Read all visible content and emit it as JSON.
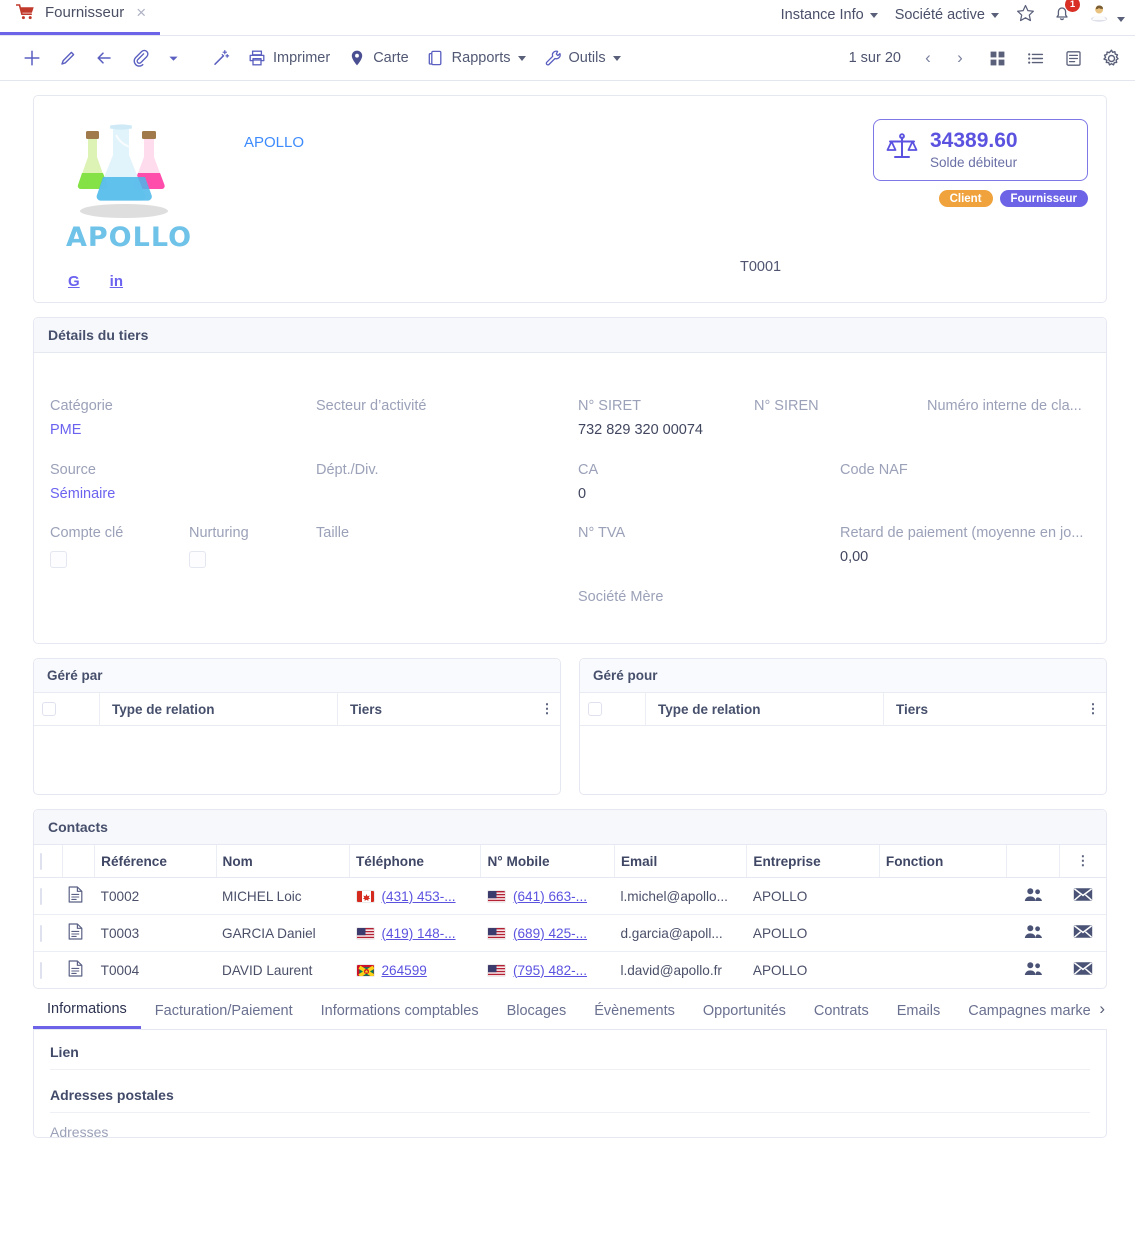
{
  "window": {
    "tab": {
      "icon": "cart-icon",
      "title": "Fournisseur",
      "close": "×"
    },
    "top_menus": [
      {
        "label": "Instance Info",
        "name": "instance-info-menu"
      },
      {
        "label": "Société active",
        "name": "active-company-menu"
      }
    ],
    "notification_count": "1"
  },
  "toolbar": {
    "buttons": [
      {
        "name": "new-button",
        "icon": "plus-icon",
        "label": ""
      },
      {
        "name": "edit-button",
        "icon": "pencil-icon",
        "label": ""
      },
      {
        "name": "back-button",
        "icon": "arrow-left-icon",
        "label": ""
      },
      {
        "name": "attachment-button",
        "icon": "paperclip-icon",
        "label": ""
      },
      {
        "name": "more-actions-button",
        "icon": "chevron-down-icon",
        "label": ""
      },
      {
        "name": "magic-button",
        "icon": "magic-wand-icon",
        "label": ""
      },
      {
        "name": "print-button",
        "icon": "printer-icon",
        "label": "Imprimer"
      },
      {
        "name": "map-button",
        "icon": "map-pin-icon",
        "label": "Carte"
      },
      {
        "name": "reports-button",
        "icon": "report-icon",
        "label": "Rapports"
      },
      {
        "name": "tools-button",
        "icon": "wrench-icon",
        "label": "Outils"
      }
    ],
    "pager": {
      "count_text": "1 sur 20",
      "prev": "‹",
      "next": "›"
    },
    "views": [
      "grid-view-icon",
      "list-view-icon",
      "detail-view-icon",
      "gear-icon"
    ]
  },
  "identity": {
    "logo_word": "APOLLO",
    "party_name": "APOLLO",
    "reference": "T0001",
    "social": [
      {
        "label": "G",
        "name": "google-link"
      },
      {
        "label": "in",
        "name": "linkedin-link"
      }
    ],
    "balance": {
      "icon": "scales-icon",
      "amount": "34389.60",
      "label": "Solde débiteur"
    },
    "chips": [
      {
        "label": "Client",
        "color": "#f0a23c"
      },
      {
        "label": "Fournisseur",
        "color": "#6d63e6"
      }
    ]
  },
  "details": {
    "title": "Détails du tiers",
    "fields": [
      {
        "label": "Catégorie",
        "value": "PME",
        "link": true
      },
      {
        "label": "Secteur d’activité",
        "value": ""
      },
      {
        "label": "N° SIRET",
        "value": "732 829 320 00074"
      },
      {
        "label": "N° SIREN",
        "value": ""
      },
      {
        "label": "Numéro interne de cla...",
        "value": ""
      },
      {
        "label": "Source",
        "value": "Séminaire",
        "link": true
      },
      {
        "label": "Dépt./Div.",
        "value": ""
      },
      {
        "label": "CA",
        "value": "0"
      },
      {
        "label": "Code NAF",
        "value": ""
      },
      {
        "label": "Compte clé",
        "value": "",
        "checkbox": true
      },
      {
        "label": "Nurturing",
        "value": "",
        "checkbox": true
      },
      {
        "label": "Taille",
        "value": ""
      },
      {
        "label": "N° TVA",
        "value": ""
      },
      {
        "label": "Retard de paiement (moyenne en jo...",
        "value": "0,00"
      },
      {
        "label": "Société Mère",
        "value": ""
      }
    ]
  },
  "relations": {
    "managed_by": {
      "title": "Géré par",
      "columns": [
        "Type de relation",
        "Tiers"
      ],
      "rows": []
    },
    "managed_for": {
      "title": "Géré pour",
      "columns": [
        "Type de relation",
        "Tiers"
      ],
      "rows": []
    }
  },
  "contacts": {
    "title": "Contacts",
    "columns": [
      "Référence",
      "Nom",
      "Téléphone",
      "N° Mobile",
      "Email",
      "Entreprise",
      "Fonction"
    ],
    "rows": [
      {
        "reference": "T0002",
        "nom": "MICHEL Loic",
        "telephone": "(431) 453-...",
        "telephone_flag": "CA",
        "mobile": "(641) 663-...",
        "mobile_flag": "US",
        "email": "l.michel@apollo...",
        "entreprise": "APOLLO",
        "fonction": ""
      },
      {
        "reference": "T0003",
        "nom": "GARCIA Daniel",
        "telephone": "(419) 148-...",
        "telephone_flag": "US",
        "mobile": "(689) 425-...",
        "mobile_flag": "US",
        "email": "d.garcia@apoll...",
        "entreprise": "APOLLO",
        "fonction": ""
      },
      {
        "reference": "T0004",
        "nom": "DAVID Laurent",
        "telephone": "264599",
        "telephone_flag": "GD",
        "mobile": "(795) 482-...",
        "mobile_flag": "US",
        "email": "l.david@apollo.fr",
        "entreprise": "APOLLO",
        "fonction": ""
      }
    ]
  },
  "bottom_tabs": {
    "items": [
      "Informations",
      "Facturation/Paiement",
      "Informations comptables",
      "Blocages",
      "Évènements",
      "Opportunités",
      "Contrats",
      "Emails",
      "Campagnes marke"
    ],
    "active_index": 0,
    "more": "›"
  },
  "info_panel": {
    "link_title": "Lien",
    "addresses_title": "Adresses postales",
    "addresses_sub": "Adresses"
  },
  "colors": {
    "accent": "#6c63e8",
    "link": "#6b63ef",
    "client_chip": "#f0a23c",
    "supplier_chip": "#6d63e6",
    "balance": "#5b52e0",
    "notification": "#d93025"
  }
}
